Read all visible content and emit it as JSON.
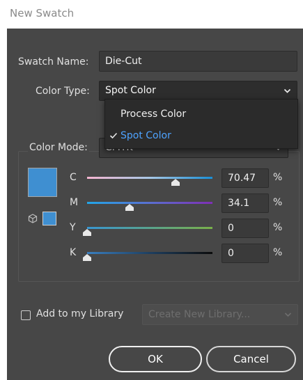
{
  "window": {
    "title": "New Swatch"
  },
  "swatch_name": {
    "label": "Swatch Name:",
    "value": "Die-Cut"
  },
  "color_type": {
    "label": "Color Type:",
    "selected": "Spot Color",
    "options": [
      "Process Color",
      "Spot Color"
    ]
  },
  "color_mode": {
    "label": "Color Mode:",
    "selected": "CMYK"
  },
  "swatch_color": "#3f8fd1",
  "icons": {
    "gamut": "cube-icon",
    "dropdown": "chevron-down-icon",
    "check": "checkmark-icon"
  },
  "channels": [
    {
      "name": "C",
      "value": "70.47",
      "level": 0.7047,
      "unit": "%"
    },
    {
      "name": "M",
      "value": "34.1",
      "level": 0.341,
      "unit": "%"
    },
    {
      "name": "Y",
      "value": "0",
      "level": 0,
      "unit": "%"
    },
    {
      "name": "K",
      "value": "0",
      "level": 0,
      "unit": "%"
    }
  ],
  "library": {
    "checkbox_label": "Add to my Library",
    "checked": false,
    "select_placeholder": "Create New Library..."
  },
  "buttons": {
    "ok": "OK",
    "cancel": "Cancel"
  },
  "colors": {
    "dialog_bg": "#474747",
    "menu_highlight": "#4ea3ff",
    "track_c": [
      "#f5b5d0",
      "#1a8fd6"
    ],
    "track_m": [
      "#22a6e8",
      "#7f2fb5"
    ],
    "track_y": [
      "#3896d1",
      "#79b04a"
    ],
    "track_k": [
      "#3a7fc0",
      "#0c0c0c"
    ]
  }
}
